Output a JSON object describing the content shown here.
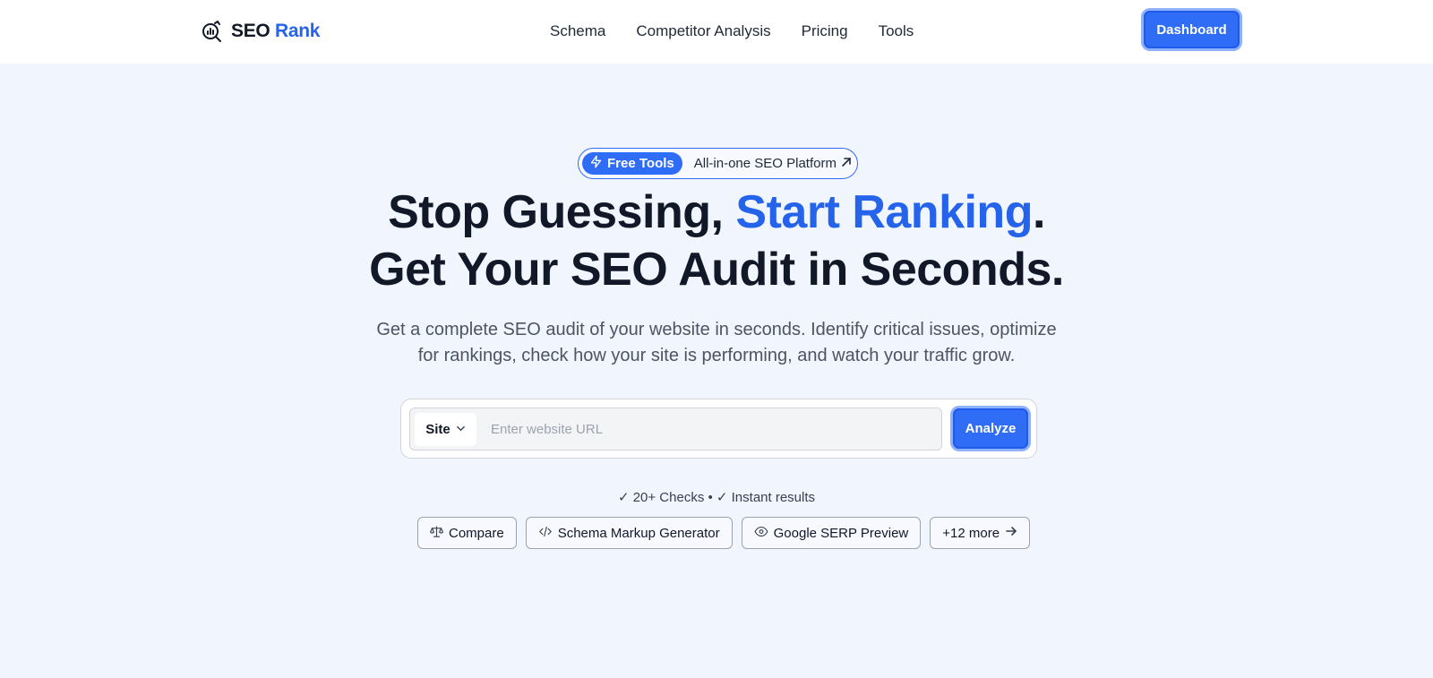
{
  "brand": {
    "name_part1": "SEO",
    "name_part2": "Rank",
    "icon": "chart-magnifier-icon"
  },
  "nav": {
    "items": [
      {
        "label": "Schema"
      },
      {
        "label": "Competitor Analysis"
      },
      {
        "label": "Pricing"
      },
      {
        "label": "Tools"
      }
    ],
    "dashboard_label": "Dashboard"
  },
  "hero": {
    "badge": {
      "tag_label": "Free Tools",
      "tag_icon": "lightning-icon",
      "text": "All-in-one SEO Platform",
      "text_icon": "arrow-up-right-icon"
    },
    "headline_line1_a": "Stop Guessing, ",
    "headline_line1_highlight": "Start Ranking",
    "headline_line1_end": ".",
    "headline_line2": "Get Your SEO Audit in Seconds.",
    "subtext_line1": "Get a complete SEO audit of your website in seconds. Identify critical issues, optimize",
    "subtext_line2": "for rankings, check how your site is performing, and watch your traffic grow."
  },
  "search": {
    "select_value": "Site",
    "placeholder": "Enter website URL",
    "value": "",
    "analyze_label": "Analyze"
  },
  "checks_text": "✓ 20+ Checks • ✓ Instant results",
  "tools": [
    {
      "label": "Compare",
      "icon": "scale-icon"
    },
    {
      "label": "Schema Markup Generator",
      "icon": "code-icon"
    },
    {
      "label": "Google SERP Preview",
      "icon": "eye-icon"
    },
    {
      "label": "+12 more",
      "icon": "arrow-right-icon"
    }
  ],
  "colors": {
    "accent": "#2f6df6",
    "headline_highlight": "#2563eb",
    "page_background": "#f1f5fd",
    "header_background": "#ffffff",
    "text_primary": "#111827",
    "text_muted": "#4b5563"
  }
}
